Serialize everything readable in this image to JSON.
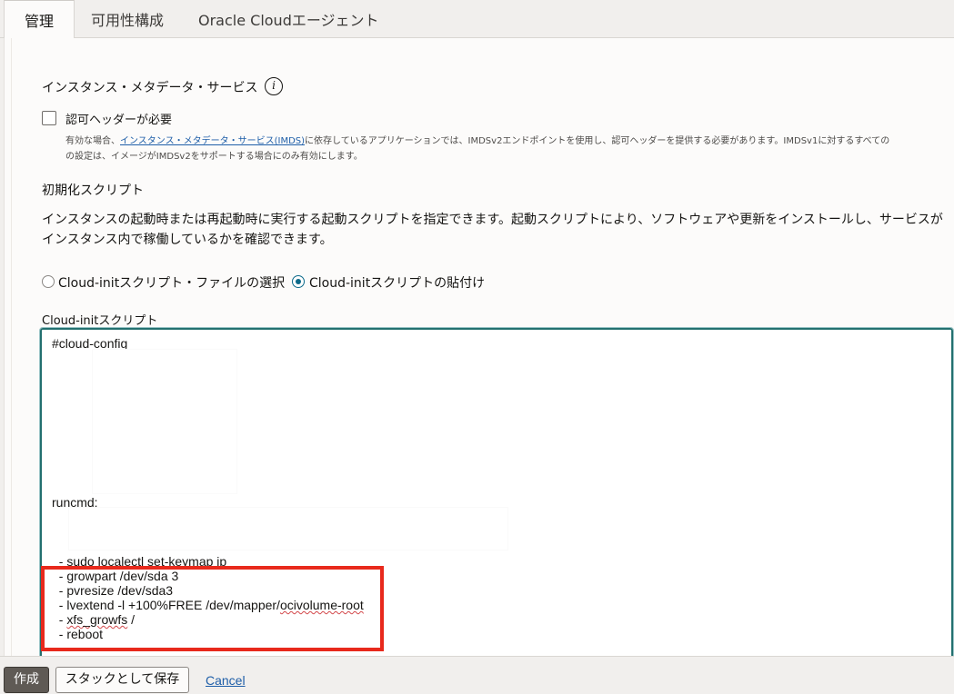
{
  "tabs": [
    {
      "label": "管理",
      "active": true
    },
    {
      "label": "可用性構成",
      "active": false
    },
    {
      "label": "Oracle Cloudエージェント",
      "active": false
    }
  ],
  "imds": {
    "title": "インスタンス・メタデータ・サービス",
    "info_icon": "info-icon",
    "checkbox_label": "認可ヘッダーが必要",
    "checked": false,
    "help_prefix": "有効な場合、",
    "help_link": "インスタンス・メタデータ・サービス(IMDS)",
    "help_rest": "に依存しているアプリケーションでは、IMDSv2エンドポイントを使用し、認可ヘッダーを提供する必要があります。IMDSv1に対するすべての",
    "help_line2": "の設定は、イメージがIMDSv2をサポートする場合にのみ有効にします。"
  },
  "init_script": {
    "title": "初期化スクリプト",
    "description": "インスタンスの起動時または再起動時に実行する起動スクリプトを指定できます。起動スクリプトにより、ソフトウェアや更新をインストールし、サービスがインスタンス内で稼働しているかを確認できます。",
    "radio_options": [
      {
        "label": "Cloud-initスクリプト・ファイルの選択",
        "selected": false
      },
      {
        "label": "Cloud-initスクリプトの貼付け",
        "selected": true
      }
    ],
    "field_label": "Cloud-initスクリプト",
    "code": {
      "header": "#cloud-config",
      "runcmd": "runcmd:",
      "line_keymap": "  - sudo localectl set-keymap jp",
      "line_growpart": "  - growpart /dev/sda 3",
      "line_pvresize": "  - pvresize /dev/sda3",
      "line_lvextend_prefix": "  - lvextend -l +100%FREE /dev/mapper/",
      "line_lvextend_volume": "ocivolume-root",
      "line_xfs_prefix": "  - ",
      "line_xfs_cmd": "xfs_growfs",
      "line_xfs_suffix": " /",
      "line_reboot": "  - reboot"
    }
  },
  "footer": {
    "create_label": "作成",
    "save_stack_label": "スタックとして保存",
    "cancel_label": "Cancel"
  },
  "colors": {
    "accent_teal": "#23706f",
    "link_blue": "#1e5ea8",
    "highlight_red": "#e8291c",
    "primary_button": "#5f5a55"
  }
}
